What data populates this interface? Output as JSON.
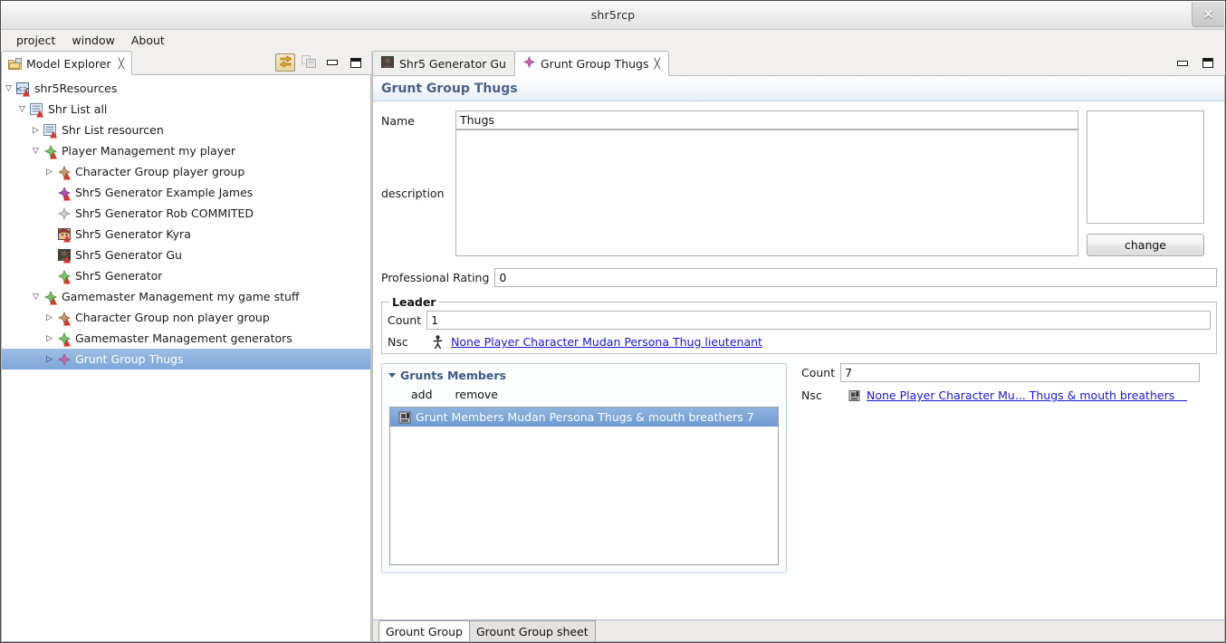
{
  "window": {
    "title": "shr5rcp",
    "close_label": "✕"
  },
  "menubar": {
    "items": [
      {
        "label": "project"
      },
      {
        "label": "window"
      },
      {
        "label": "About"
      }
    ]
  },
  "explorer": {
    "tab_label": "Model Explorer",
    "tab_close": "╳",
    "toolbar": [
      {
        "name": "link-with-editor-icon",
        "state": "pressed"
      },
      {
        "name": "collapse-all-icon",
        "state": "disabled"
      },
      {
        "name": "minimize-icon",
        "state": "normal"
      },
      {
        "name": "maximize-icon",
        "state": "normal"
      }
    ],
    "tree": [
      {
        "label": "shr5Resources",
        "depth": 0,
        "twisty": "down",
        "icon": "resource-icon",
        "selected": false
      },
      {
        "label": "Shr List all",
        "depth": 1,
        "twisty": "down",
        "icon": "list-icon",
        "selected": false
      },
      {
        "label": "Shr List resourcen",
        "depth": 2,
        "twisty": "right",
        "icon": "list-icon",
        "selected": false
      },
      {
        "label": "Player Management my player",
        "depth": 2,
        "twisty": "down",
        "icon": "green-diamond-icon",
        "selected": false
      },
      {
        "label": "Character Group player group",
        "depth": 3,
        "twisty": "right",
        "icon": "brown-diamond-icon",
        "selected": false
      },
      {
        "label": "Shr5 Generator Example James",
        "depth": 3,
        "twisty": "none",
        "icon": "purple-diamond-icon",
        "selected": false
      },
      {
        "label": "Shr5 Generator Rob COMMITED",
        "depth": 3,
        "twisty": "none",
        "icon": "grey-diamond-icon",
        "selected": false
      },
      {
        "label": "Shr5 Generator Kyra",
        "depth": 3,
        "twisty": "none",
        "icon": "portrait-kyra-icon",
        "selected": false
      },
      {
        "label": "Shr5 Generator Gu",
        "depth": 3,
        "twisty": "none",
        "icon": "portrait-gu-icon",
        "selected": false
      },
      {
        "label": "Shr5 Generator",
        "depth": 3,
        "twisty": "none",
        "icon": "green-diamond-icon",
        "selected": false
      },
      {
        "label": "Gamemaster Management my game stuff",
        "depth": 2,
        "twisty": "down",
        "icon": "green-diamond-icon",
        "selected": false
      },
      {
        "label": "Character Group non player group",
        "depth": 3,
        "twisty": "right",
        "icon": "brown-diamond-icon",
        "selected": false
      },
      {
        "label": "Gamemaster Management generators",
        "depth": 3,
        "twisty": "right",
        "icon": "green-diamond-icon",
        "selected": false
      },
      {
        "label": "Grunt Group Thugs",
        "depth": 3,
        "twisty": "right",
        "icon": "pink-diamond-icon",
        "selected": true
      }
    ]
  },
  "editor": {
    "tabs": [
      {
        "label": "Shr5 Generator Gu",
        "icon": "portrait-gu-icon",
        "active": false,
        "closeable": false
      },
      {
        "label": "Grunt Group Thugs",
        "icon": "pink-diamond-icon",
        "active": true,
        "closeable": true,
        "close": "╳"
      }
    ],
    "toolbar": [
      {
        "name": "minimize-icon"
      },
      {
        "name": "maximize-icon"
      }
    ],
    "form_title": "Grunt Group Thugs",
    "fields": {
      "name_label": "Name",
      "name_value": "Thugs",
      "description_label": "description",
      "description_value": "",
      "change_button": "change",
      "professional_rating_label": "Professional Rating",
      "professional_rating_value": "0"
    },
    "leader_group": {
      "legend": "Leader",
      "count_label": "Count",
      "count_value": "1",
      "nsc_label": "Nsc",
      "nsc_link": "None Player Character Mudan Persona Thug lieutenant",
      "nsc_icon": "person-icon"
    },
    "grunts_members": {
      "title": "Grunts Members",
      "add_label": "add",
      "remove_label": "remove",
      "rows": [
        {
          "label": "Grunt Members Mudan Persona Thugs & mouth breathers 7",
          "icon": "grunt-icon",
          "selected": true
        }
      ]
    },
    "grunt_detail": {
      "count_label": "Count",
      "count_value": "7",
      "nsc_label": "Nsc",
      "nsc_link": "None Player Character Mu... Thugs & mouth breathers",
      "nsc_icon": "grunt-icon"
    },
    "bottom_tabs": [
      {
        "label": "Grount Group",
        "active": true
      },
      {
        "label": "Grount Group sheet",
        "active": false
      }
    ]
  },
  "colors": {
    "selection": "#7ea7d8",
    "link": "#1717d0",
    "form_title": "#4b6087",
    "section_title": "#3c5a85"
  }
}
